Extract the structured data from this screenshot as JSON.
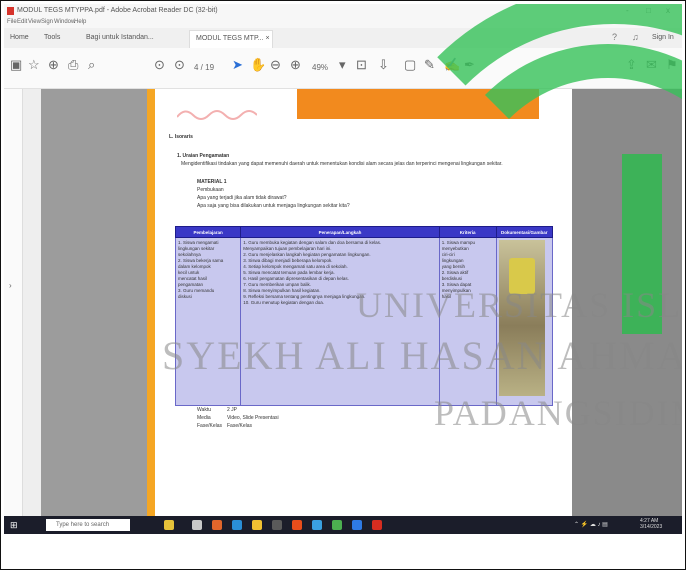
{
  "window": {
    "title": "MODUL TEGS MTYPPA.pdf - Adobe Acrobat Reader DC (32-bit)",
    "controls": [
      "-",
      "□",
      "x"
    ]
  },
  "menu": [
    "File",
    "Edit",
    "View",
    "Sign",
    "Window",
    "Help"
  ],
  "tabs": {
    "home": "Home",
    "tools": "Tools",
    "nav_tab": "Bagi untuk Istandan...",
    "document": "MODUL TEGS MTP... ×",
    "signin": "Sign In"
  },
  "toolbar": {
    "page": "4 / 19",
    "zoom": "49%"
  },
  "document": {
    "section": "L. Isoraris",
    "subheading": "1. Uraian Pengamatan",
    "intro": "Mengidentifikasi tindakan yang dapat memenuhi daerah untuk menentukan kondisi alam secara jelas dan terperinci mengenai lingkungan sekitar.",
    "material": "MATERIAL 1",
    "material_sub": "Pembukaan",
    "q1": "Apa yang terjadi jika alam tidak dirawat?",
    "q2": "Apa saja yang bisa dilakukan untuk menjaga lingkungan sekitar kita?",
    "table": {
      "headers": [
        "Pembelajaran",
        "Penerapan/Langkah",
        "Kriteria",
        "Dokumentasi/Gambar"
      ],
      "col1": [
        "1. Siswa mengamati",
        "   lingkungan sekitar",
        "   sekolahnya",
        "2. Siswa bekerja sama",
        "   dalam kelompok",
        "   kecil untuk",
        "   mencatat hasil",
        "   pengamatan",
        "3. Guru memandu",
        "   diskusi"
      ],
      "col2": [
        "1. Guru membuka kegiatan dengan salam dan doa bersama di kelas.",
        "   Menyampaikan tujuan pembelajaran hari ini.",
        "2. Guru menjelaskan langkah kegiatan pengamatan lingkungan.",
        "3. Siswa dibagi menjadi beberapa kelompok.",
        "4. Setiap kelompok mengamati satu area di sekolah.",
        "5. Siswa mencatat temuan pada lembar kerja.",
        "6. Hasil pengamatan dipresentasikan di depan kelas.",
        "7. Guru memberikan umpan balik.",
        "8. Siswa menyimpulkan hasil kegiatan.",
        "9. Refleksi bersama tentang pentingnya menjaga lingkungan.",
        "10. Guru menutup kegiatan dengan doa."
      ],
      "col3": [
        "1. Siswa mampu",
        "   menyebutkan",
        "   ciri-ciri",
        "   lingkungan",
        "   yang bersih",
        "2. Siswa aktif",
        "   berdiskusi",
        "3. Siswa dapat",
        "   menyimpulkan",
        "   hasil"
      ]
    },
    "meta": [
      {
        "label": "Waktu",
        "value": "2 JP"
      },
      {
        "label": "Media",
        "value": "Video, Slide Presentasi"
      },
      {
        "label": "Fase/Kelas",
        "value": "Fase/Kelas"
      }
    ]
  },
  "watermark": [
    "UNIVERSITAS ISLAM NEGERI",
    "SYEKH ALI HASAN AHMAD",
    "PADANGSIDIMPUAN"
  ],
  "taskbar": {
    "search_placeholder": "Type here to search",
    "clock_time": "4:27 AM",
    "clock_date": "3/14/2023"
  }
}
